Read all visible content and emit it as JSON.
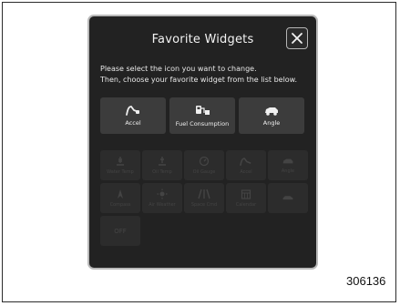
{
  "dialog": {
    "title": "Favorite Widgets",
    "instructions": [
      "Please select the icon you want to change.",
      "Then, choose your favorite widget from the list below."
    ],
    "close_icon": "close-icon"
  },
  "selected_widgets": [
    {
      "label": "Accel",
      "icon": "accel-icon"
    },
    {
      "label": "Fuel Consumption",
      "icon": "fuel-consumption-icon"
    },
    {
      "label": "Angle",
      "icon": "angle-icon"
    }
  ],
  "widget_list": [
    {
      "label": "Water Temp",
      "icon": "water-temp-icon"
    },
    {
      "label": "Oil Temp",
      "icon": "oil-temp-icon"
    },
    {
      "label": "Oil Gauge",
      "icon": "gauge-icon"
    },
    {
      "label": "Accel",
      "icon": "accel-icon"
    },
    {
      "label": "Angle",
      "icon": "angle-icon"
    },
    {
      "label": "Compass",
      "icon": "compass-icon"
    },
    {
      "label": "Air Weather",
      "icon": "weather-icon"
    },
    {
      "label": "Space Cmd",
      "icon": "space-icon"
    },
    {
      "label": "Calendar",
      "icon": "calendar-icon"
    },
    {
      "label": "",
      "icon": "car-icon"
    },
    {
      "label": "OFF",
      "icon": ""
    }
  ],
  "figure_code": "306136",
  "colors": {
    "screen_bg": "#222222",
    "tile_active": "#3c3c3c",
    "tile_inactive": "#2c2c2c",
    "text_light": "#f0f0f0",
    "text_dim": "#444444"
  }
}
